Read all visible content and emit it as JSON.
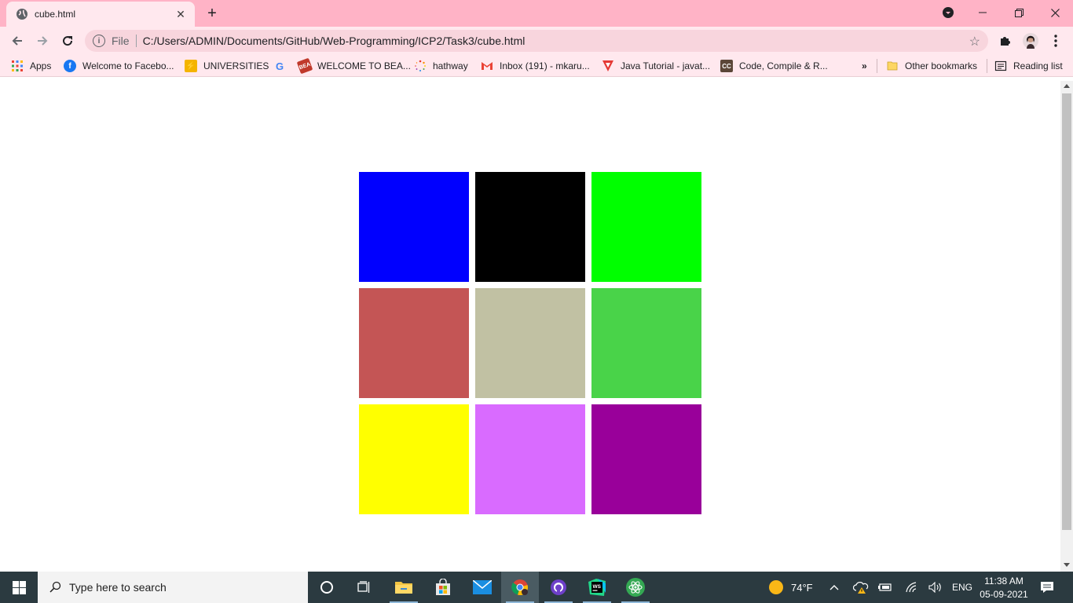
{
  "tab": {
    "title": "cube.html",
    "close": "✕",
    "new_tab": "+"
  },
  "window": {
    "minimize": "—",
    "restore": "❐",
    "close": "✕"
  },
  "omnibox": {
    "scheme": "File",
    "url": "C:/Users/ADMIN/Documents/GitHub/Web-Programming/ICP2/Task3/cube.html",
    "info_glyph": "i",
    "star": "☆"
  },
  "bookmarks": {
    "items": [
      {
        "label": "Apps",
        "icon": "apps-grid-icon"
      },
      {
        "label": "Welcome to Facebo...",
        "icon": "facebook-icon"
      },
      {
        "label": "UNIVERSITIES",
        "icon": "universities-icon"
      },
      {
        "label": "",
        "icon": "google-icon"
      },
      {
        "label": "WELCOME TO BEA...",
        "icon": "bea-icon"
      },
      {
        "label": "hathway",
        "icon": "hathway-icon"
      },
      {
        "label": "Inbox (191) - mkaru...",
        "icon": "gmail-icon"
      },
      {
        "label": "Java Tutorial - javat...",
        "icon": "javatpoint-icon"
      },
      {
        "label": "Code, Compile & R...",
        "icon": "codechef-icon"
      }
    ],
    "overflow": "»",
    "other": "Other bookmarks",
    "reading_list": "Reading list"
  },
  "cube": {
    "colors": [
      "#0000ff",
      "#000000",
      "#00ff00",
      "#c45555",
      "#c1c1a3",
      "#49d349",
      "#ffff00",
      "#d96bff",
      "#99009a"
    ]
  },
  "taskbar": {
    "search_placeholder": "Type here to search",
    "weather": "74°F",
    "language": "ENG",
    "time": "11:38 AM",
    "date": "05-09-2021"
  }
}
